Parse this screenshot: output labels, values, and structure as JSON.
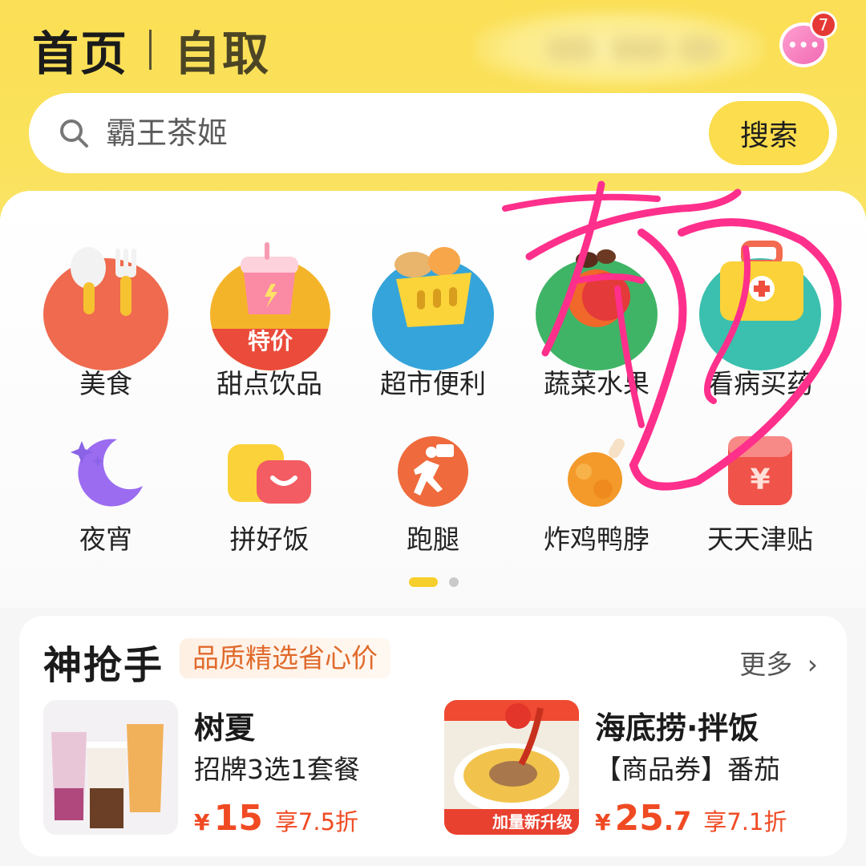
{
  "header": {
    "tab_active": "首页",
    "tab_inactive": "自取",
    "message_badge": "7",
    "message_icon": "chat-bubble-icon"
  },
  "search": {
    "placeholder": "霸王茶姬",
    "button_label": "搜索"
  },
  "categories": [
    {
      "label": "美食",
      "icon": "cutlery-icon"
    },
    {
      "label": "甜点饮品",
      "icon": "drink-cup-icon",
      "badge": "特价"
    },
    {
      "label": "超市便利",
      "icon": "shopping-basket-icon"
    },
    {
      "label": "蔬菜水果",
      "icon": "apple-icon"
    },
    {
      "label": "看病买药",
      "icon": "medicine-box-icon"
    },
    {
      "label": "夜宵",
      "icon": "moon-icon"
    },
    {
      "label": "拼好饭",
      "icon": "bowls-icon"
    },
    {
      "label": "跑腿",
      "icon": "runner-icon"
    },
    {
      "label": "炸鸡鸭脖",
      "icon": "fried-chicken-icon"
    },
    {
      "label": "天天津贴",
      "icon": "red-envelope-icon"
    }
  ],
  "pager": {
    "pages": 2,
    "active": 1
  },
  "promo": {
    "title": "神抢手",
    "tag": "品质精选省心价",
    "more_label": "更多",
    "items": [
      {
        "name": "树夏",
        "desc": "招牌3选1套餐",
        "currency": "¥",
        "price": "15",
        "price_dec": "",
        "discount": "享7.5折"
      },
      {
        "name": "海底捞·拌饭",
        "desc": "【商品券】番茄",
        "currency": "¥",
        "price": "25",
        "price_dec": ".7",
        "discount": "享7.1折",
        "image_text": "加量新升级"
      }
    ]
  },
  "colors": {
    "brand_yellow": "#fbdd4d",
    "price_red": "#f04a23",
    "tag_orange": "#e06a2c",
    "scribble_pink": "#ff2f8c"
  }
}
